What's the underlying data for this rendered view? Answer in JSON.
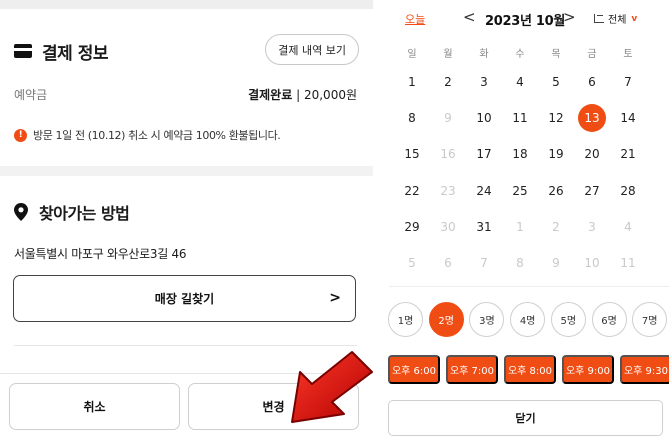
{
  "payment": {
    "title": "결제 정보",
    "history_button": "결제 내역 보기",
    "deposit_label": "예약금",
    "status": "결제완료",
    "separator": "|",
    "amount": "20,000원",
    "notice": "방문 1일 전 (10.12) 취소 시 예약금 100% 환불됩니다.",
    "notice_icon": "!"
  },
  "directions": {
    "title": "찾아가는 방법",
    "address": "서울특별시 마포구 와우산로3길 46",
    "route_button": "매장 길찾기",
    "route_chevron": ">"
  },
  "actions": {
    "cancel": "취소",
    "change": "변경"
  },
  "calendar": {
    "today": "오늘",
    "prev": "<",
    "month": "2023년 10월",
    "next": ">",
    "filter_label": "전체",
    "filter_chevron": "v",
    "weekdays": [
      "일",
      "월",
      "화",
      "수",
      "목",
      "금",
      "토"
    ],
    "weeks": [
      [
        {
          "d": "1"
        },
        {
          "d": "2"
        },
        {
          "d": "3"
        },
        {
          "d": "4"
        },
        {
          "d": "5"
        },
        {
          "d": "6"
        },
        {
          "d": "7"
        }
      ],
      [
        {
          "d": "8"
        },
        {
          "d": "9",
          "muted": true
        },
        {
          "d": "10"
        },
        {
          "d": "11"
        },
        {
          "d": "12"
        },
        {
          "d": "13",
          "selected": true
        },
        {
          "d": "14"
        }
      ],
      [
        {
          "d": "15"
        },
        {
          "d": "16",
          "muted": true
        },
        {
          "d": "17"
        },
        {
          "d": "18"
        },
        {
          "d": "19"
        },
        {
          "d": "20"
        },
        {
          "d": "21"
        }
      ],
      [
        {
          "d": "22"
        },
        {
          "d": "23",
          "muted": true
        },
        {
          "d": "24"
        },
        {
          "d": "25"
        },
        {
          "d": "26"
        },
        {
          "d": "27"
        },
        {
          "d": "28"
        }
      ],
      [
        {
          "d": "29"
        },
        {
          "d": "30",
          "muted": true
        },
        {
          "d": "31"
        },
        {
          "d": "1",
          "muted": true
        },
        {
          "d": "2",
          "muted": true
        },
        {
          "d": "3",
          "muted": true
        },
        {
          "d": "4",
          "muted": true
        }
      ],
      [
        {
          "d": "5",
          "muted": true
        },
        {
          "d": "6",
          "muted": true
        },
        {
          "d": "7",
          "muted": true
        },
        {
          "d": "8",
          "muted": true
        },
        {
          "d": "9",
          "muted": true
        },
        {
          "d": "10",
          "muted": true
        },
        {
          "d": "11",
          "muted": true
        }
      ]
    ]
  },
  "party_size": {
    "options": [
      "1명",
      "2명",
      "3명",
      "4명",
      "5명",
      "6명",
      "7명"
    ],
    "selected": "2명"
  },
  "times": [
    "오후 6:00",
    "오후 7:00",
    "오후 8:00",
    "오후 9:00",
    "오후 9:30"
  ],
  "close_button": "닫기",
  "colors": {
    "accent": "#f04d15",
    "arrow": "#e01010"
  }
}
